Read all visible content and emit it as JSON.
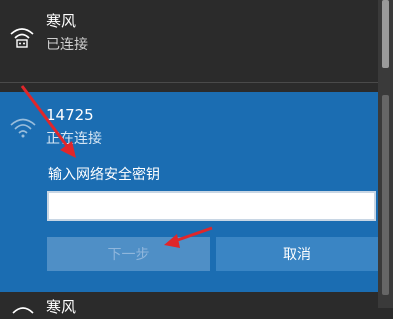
{
  "networks": [
    {
      "name": "寒风",
      "status": "已连接",
      "icon": "wifi-secured-icon"
    },
    {
      "name": "14725",
      "status": "正在连接",
      "icon": "wifi-icon",
      "key_prompt": "输入网络安全密钥",
      "key_value": "",
      "next_label": "下一步",
      "cancel_label": "取消"
    },
    {
      "name": "寒风",
      "icon": "wifi-icon"
    }
  ],
  "colors": {
    "panel_bg": "#2b2b2b",
    "selected_bg": "#1b6db2",
    "annotation_arrow": "#e0262a"
  }
}
